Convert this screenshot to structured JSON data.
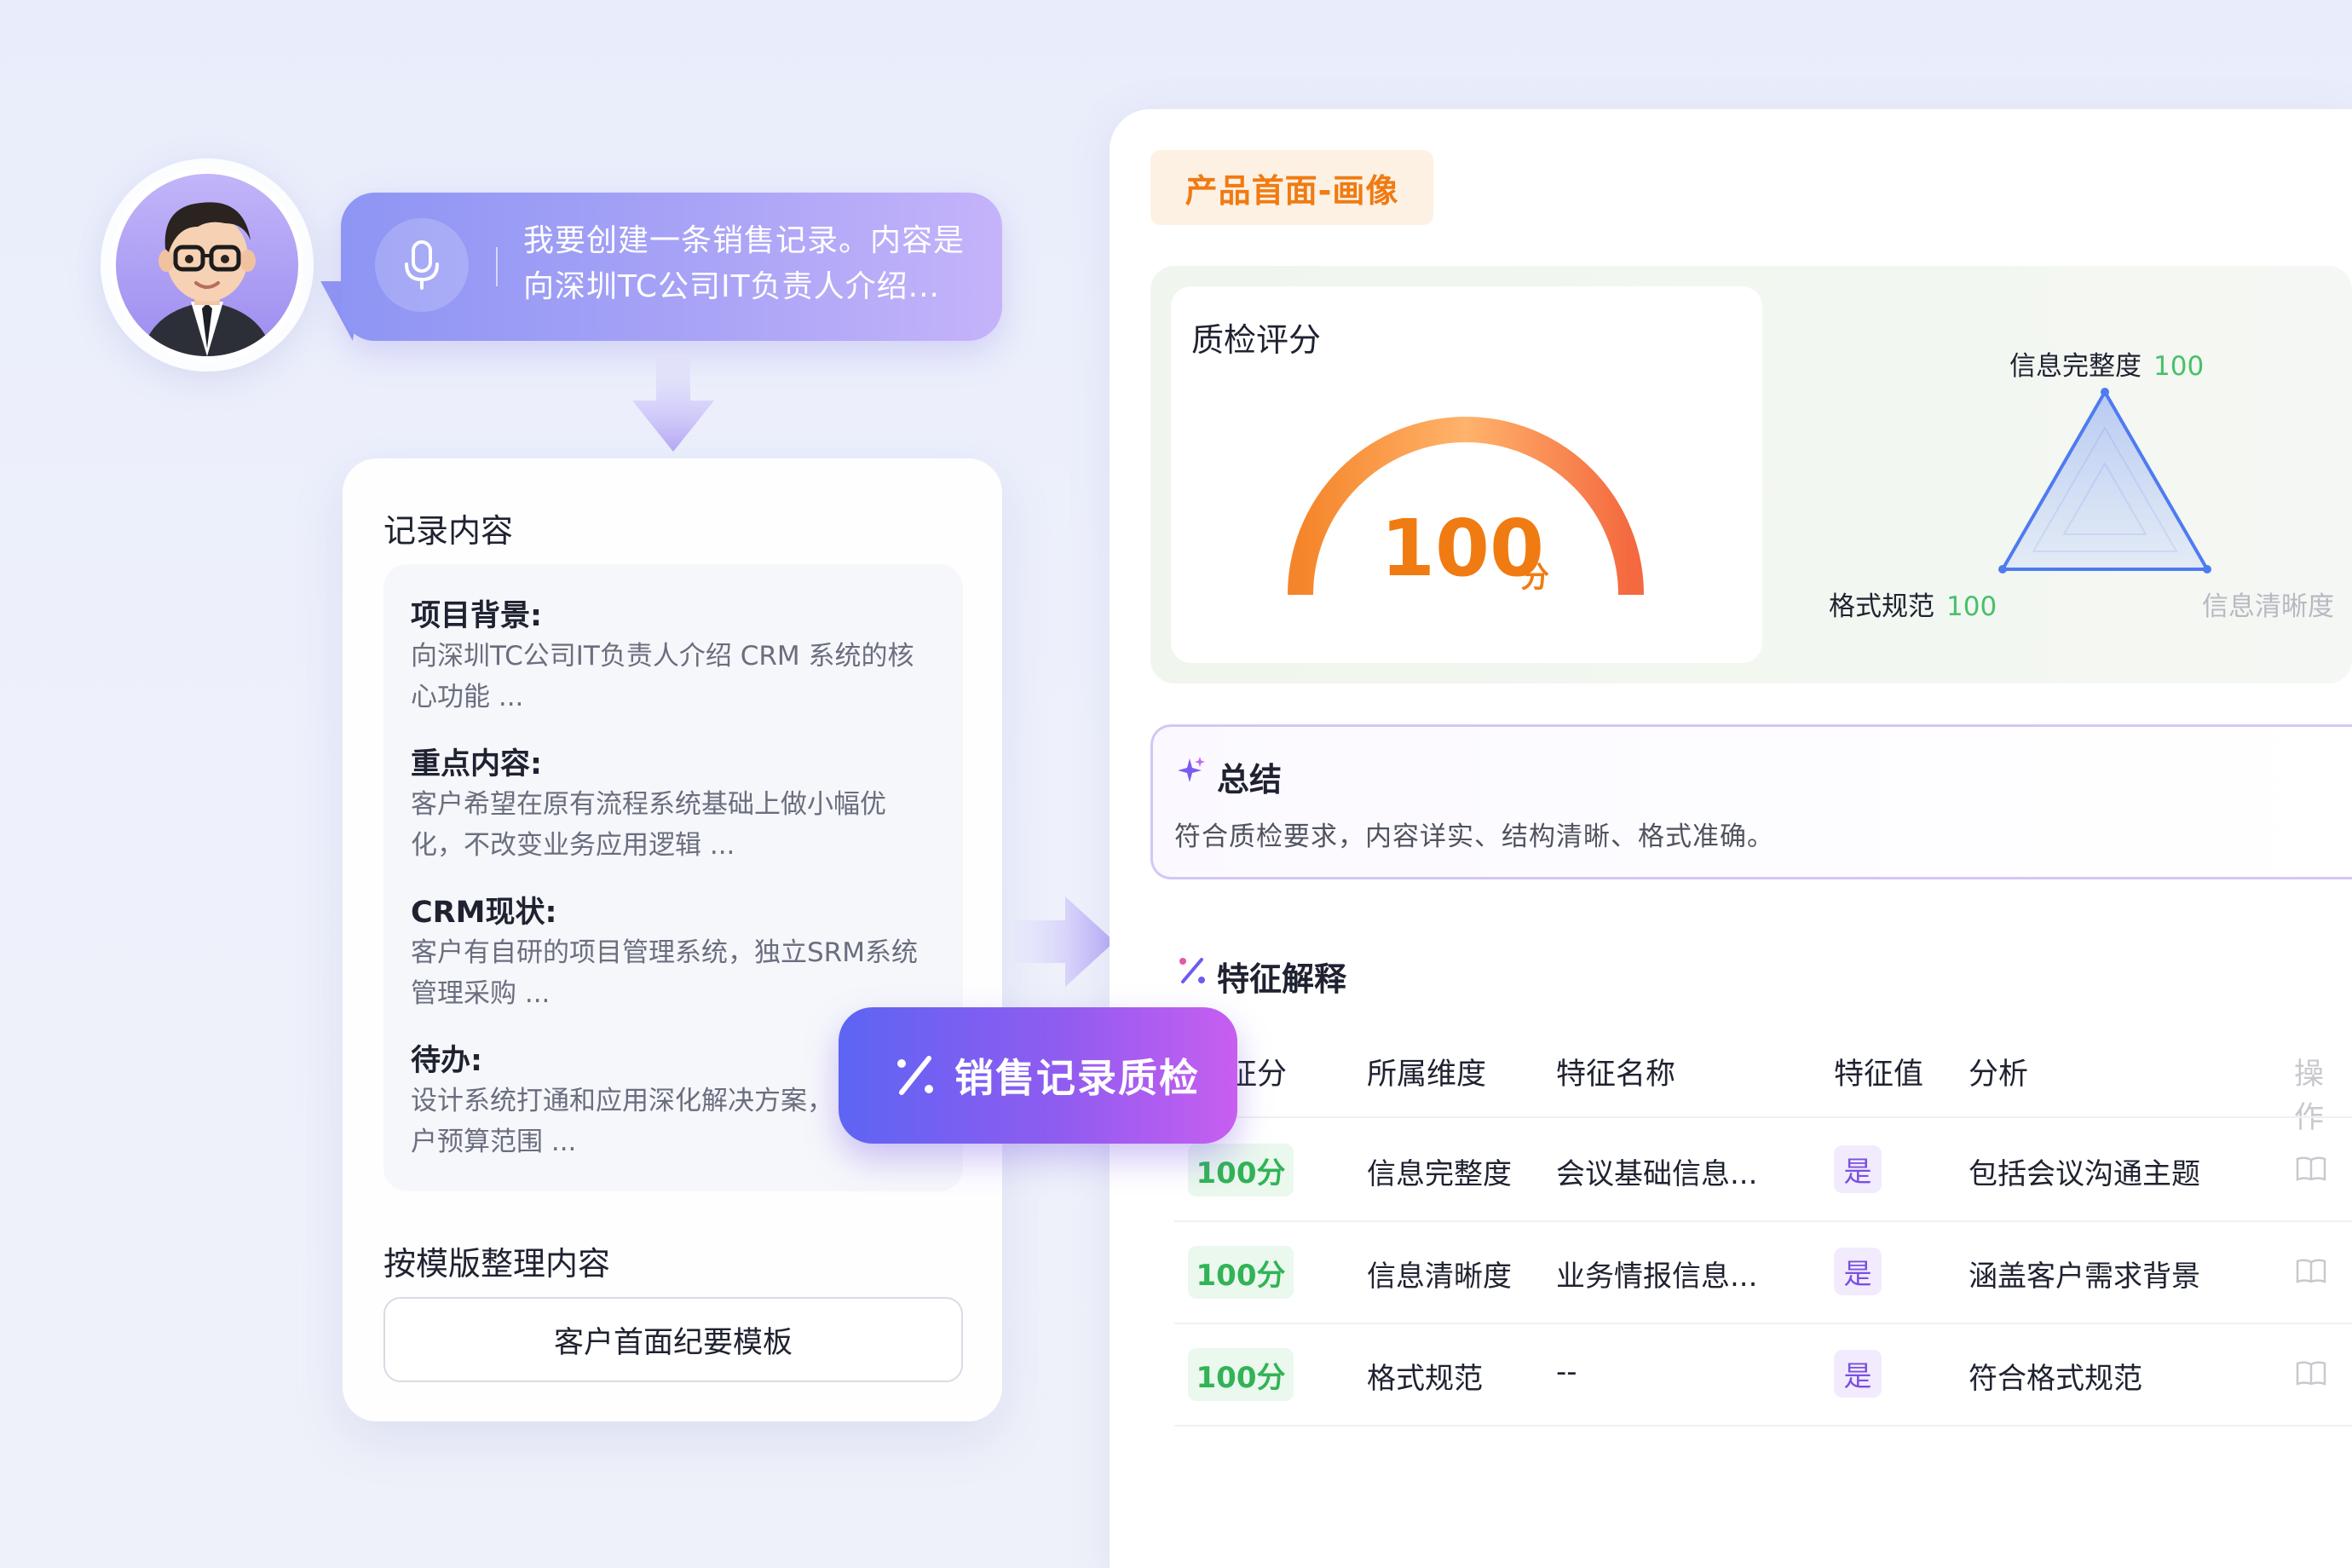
{
  "bubble": {
    "mic_icon": "microphone-icon",
    "line1": "我要创建一条销售记录。内容是",
    "line2": "向深圳TC公司IT负责人介绍..."
  },
  "record": {
    "title": "记录内容",
    "items": [
      {
        "title": "项目背景:",
        "line1": "向深圳TC公司IT负责人介绍 CRM 系统的核",
        "line2": "心功能 ..."
      },
      {
        "title": "重点内容:",
        "line1": "客户希望在原有流程系统基础上做小幅优",
        "line2": "化，不改变业务应用逻辑 ..."
      },
      {
        "title": "CRM现状:",
        "line1": "客户有自研的项目管理系统，独立SRM系统",
        "line2": "管理采购 ..."
      },
      {
        "title": "待办:",
        "line1": "设计系统打通和应用深化解决方案，",
        "line2": "户预算范围 ..."
      }
    ],
    "template_title": "按模版整理内容",
    "template_button": "客户首面纪要模板"
  },
  "action": {
    "label": "销售记录质检",
    "icon": "magic-wand-icon"
  },
  "panel": {
    "tag": "产品首面-画像",
    "score": {
      "title": "质检评分",
      "value": "100",
      "unit": "分",
      "fraction": 1.0,
      "gauge_colors": [
        "#f5852a",
        "#ffb36b",
        "#f4693f"
      ]
    },
    "radar": {
      "axes": [
        {
          "label": "信息完整度",
          "value": "100"
        },
        {
          "label": "信息清晰度",
          "value": ""
        },
        {
          "label": "格式规范",
          "value": "100"
        }
      ],
      "accent": "#4f7bf0"
    },
    "summary": {
      "icon": "sparkle-icon",
      "title": "总结",
      "text": "符合质检要求，内容详实、结构清晰、格式准确。"
    },
    "features": {
      "icon": "magic-wand-icon",
      "title": "特征解释",
      "headers": {
        "score": "征分",
        "dimension": "所属维度",
        "name": "特征名称",
        "value": "特征值",
        "analysis": "分析",
        "op": "操作"
      },
      "rows": [
        {
          "score": "100分",
          "dimension": "信息完整度",
          "name": "会议基础信息...",
          "value": "是",
          "analysis": "包括会议沟通主题"
        },
        {
          "score": "100分",
          "dimension": "信息清晰度",
          "name": "业务情报信息...",
          "value": "是",
          "analysis": "涵盖客户需求背景"
        },
        {
          "score": "100分",
          "dimension": "格式规范",
          "name": "--",
          "value": "是",
          "analysis": "符合格式规范"
        }
      ]
    }
  },
  "colors": {
    "orange": "#f07b12",
    "green": "#32b356",
    "purple": "#7b4fe0",
    "bubble_gradient": [
      "#8e95f4",
      "#c5b3fa"
    ],
    "button_gradient": [
      "#5d64f3",
      "#c85ef0"
    ]
  }
}
